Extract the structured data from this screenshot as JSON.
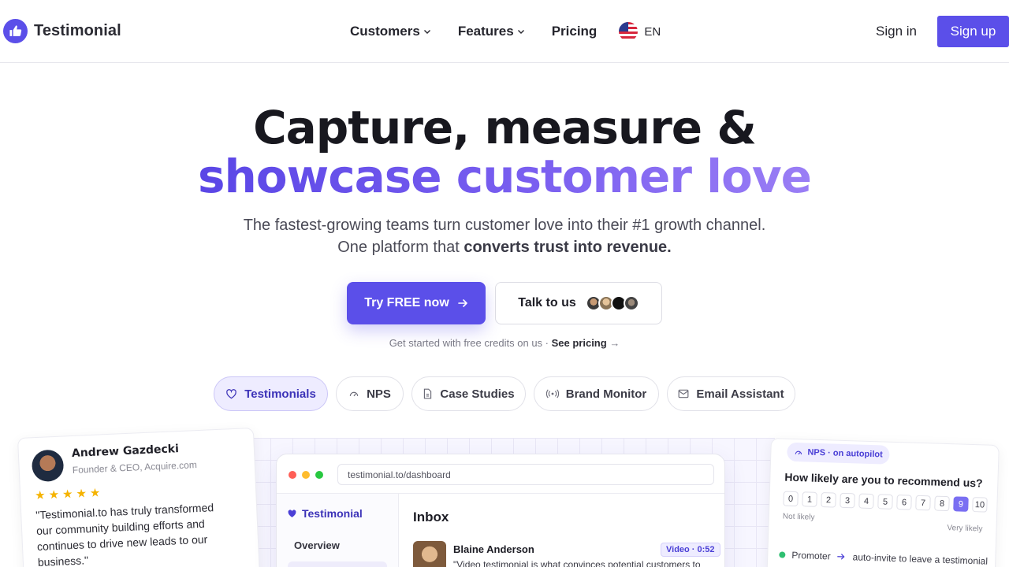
{
  "nav": {
    "brand": "Testimonial",
    "links": [
      {
        "label": "Customers",
        "has_dropdown": true
      },
      {
        "label": "Features",
        "has_dropdown": true
      },
      {
        "label": "Pricing",
        "has_dropdown": false
      }
    ],
    "language": "EN",
    "signin": "Sign in",
    "signup": "Sign up"
  },
  "hero": {
    "title_line1": "Capture, measure &",
    "title_line2": "showcase customer love",
    "subtitle_line1": "The fastest-growing teams turn customer love into their #1 growth channel.",
    "subtitle_line2_prefix": "One platform that ",
    "subtitle_line2_bold": "converts trust into revenue.",
    "cta_primary": "Try FREE now",
    "cta_secondary": "Talk to us",
    "credits_text": "Get started with free credits on us · ",
    "credits_link": "See pricing",
    "credits_arrow": "→"
  },
  "tabs": [
    {
      "label": "Testimonials",
      "icon": "heart-icon",
      "active": true
    },
    {
      "label": "NPS",
      "icon": "gauge-icon",
      "active": false
    },
    {
      "label": "Case Studies",
      "icon": "document-icon",
      "active": false
    },
    {
      "label": "Brand Monitor",
      "icon": "broadcast-icon",
      "active": false
    },
    {
      "label": "Email Assistant",
      "icon": "mail-icon",
      "active": false
    }
  ],
  "review": {
    "name": "Andrew Gazdecki",
    "title": "Founder & CEO, Acquire.com",
    "stars": "★★★★★",
    "rating": 5,
    "text": "\"Testimonial.to has truly transformed our community building efforts and continues to drive new leads to our business.\""
  },
  "dashboard": {
    "url": "testimonial.to/dashboard",
    "brand": "Testimonial",
    "nav_item": "Overview",
    "inbox_title": "Inbox",
    "message": {
      "name": "Blaine Anderson",
      "badge": "Video · 0:52",
      "text": "\"Video testimonial is what convinces potential customers to"
    }
  },
  "nps": {
    "tag": "NPS · on autopilot",
    "question": "How likely are you to recommend us?",
    "scale": [
      "0",
      "1",
      "2",
      "3",
      "4",
      "5",
      "6",
      "7",
      "8",
      "9",
      "10"
    ],
    "selected": "9",
    "low_label": "Not likely",
    "high_label": "Very likely",
    "promoter_label": "Promoter",
    "promoter_action": "auto-invite to leave a testimonial"
  },
  "colors": {
    "accent": "#5b4fe9",
    "accent_light": "#eeecff",
    "star": "#f5b300",
    "text": "#1a1a23"
  }
}
